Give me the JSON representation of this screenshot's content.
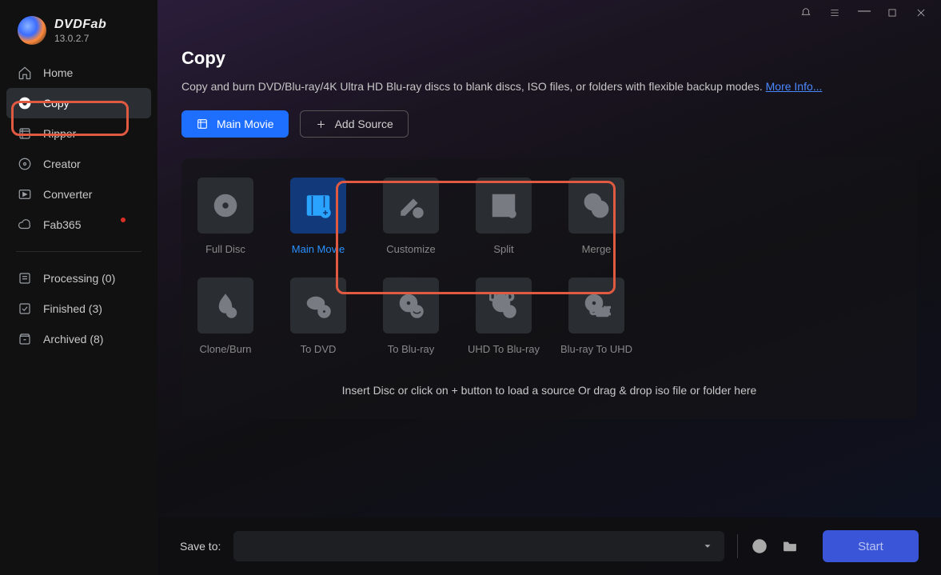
{
  "app": {
    "name": "DVDFab",
    "version": "13.0.2.7"
  },
  "titlebar": {
    "icons": [
      "notify",
      "menu",
      "minimize",
      "maximize",
      "close"
    ]
  },
  "sidebar": {
    "items": [
      {
        "label": "Home"
      },
      {
        "label": "Copy"
      },
      {
        "label": "Ripper"
      },
      {
        "label": "Creator"
      },
      {
        "label": "Converter"
      },
      {
        "label": "Fab365"
      }
    ],
    "status": [
      {
        "label": "Processing (0)"
      },
      {
        "label": "Finished (3)"
      },
      {
        "label": "Archived (8)"
      }
    ]
  },
  "page": {
    "title": "Copy",
    "desc": "Copy and burn DVD/Blu-ray/4K Ultra HD Blu-ray discs to blank discs, ISO files, or folders with flexible backup modes. ",
    "more_label": "More Info...",
    "main_movie_btn": "Main Movie",
    "add_source_btn": "Add Source",
    "modes": [
      {
        "label": "Full Disc"
      },
      {
        "label": "Main Movie"
      },
      {
        "label": "Customize"
      },
      {
        "label": "Split"
      },
      {
        "label": "Merge"
      }
    ],
    "modes2": [
      {
        "label": "Clone/Burn"
      },
      {
        "label": "To DVD"
      },
      {
        "label": "To Blu-ray"
      },
      {
        "label": "UHD To Blu-ray"
      },
      {
        "label": "Blu-ray To UHD"
      }
    ],
    "dropzone": "Insert Disc or click on + button to load a source Or drag & drop iso file or folder here"
  },
  "footer": {
    "save_label": "Save to:",
    "start": "Start"
  }
}
